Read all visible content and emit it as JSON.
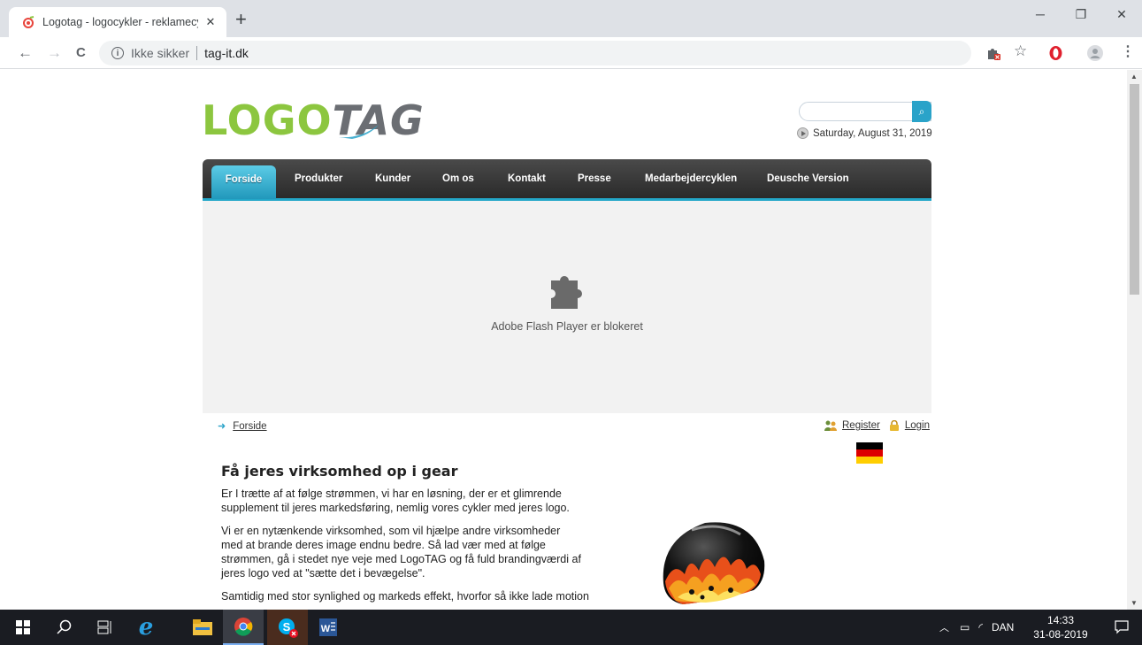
{
  "browser": {
    "tab_title": "Logotag - logocykler - reklamecy",
    "tab_close": "✕",
    "new_tab": "+",
    "security_label": "Ikke sikker",
    "url": "tag-it.dk",
    "back": "←",
    "forward": "→",
    "reload": "C"
  },
  "site": {
    "logo_part1": "LOGO",
    "logo_part2": "TAG",
    "search_button": "⌕",
    "date": "Saturday, August 31, 2019",
    "nav": [
      {
        "label": "Forside"
      },
      {
        "label": "Produkter"
      },
      {
        "label": "Kunder"
      },
      {
        "label": "Om os"
      },
      {
        "label": "Kontakt"
      },
      {
        "label": "Presse"
      },
      {
        "label": "Medarbejdercyklen"
      },
      {
        "label": "Deusche Version"
      }
    ],
    "flash_message": "Adobe Flash Player er blokeret",
    "breadcrumb": "Forside",
    "register": "Register",
    "login": "Login",
    "heading": "Få jeres virksomhed op i gear",
    "paragraphs": [
      "Er I trætte af at følge strømmen,  vi har en løsning, der er et glimrende supplement til jeres markedsføring, nemlig vores cykler med jeres logo.",
      "Vi er en nytænkende virksomhed, som vil hjælpe andre virksomheder med at brande deres image endnu bedre. Så lad vær med at følge strømmen, gå i stedet nye veje med LogoTAG og få fuld brandingværdi af jeres logo ved at \"sætte det i bevægelse\".",
      "Samtidig med stor synlighed og markeds effekt, hvorfor så ikke lade motion"
    ],
    "colors": {
      "accent": "#23a7c8",
      "logo_green": "#8cc63f",
      "nav_bg": "#333333"
    }
  },
  "taskbar": {
    "language": "DAN",
    "time": "14:33",
    "date": "31-08-2019"
  }
}
